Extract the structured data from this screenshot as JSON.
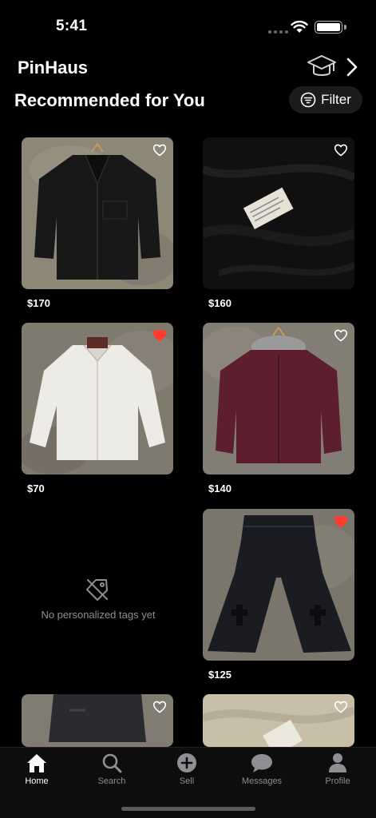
{
  "status": {
    "time": "5:41"
  },
  "header": {
    "app_title": "PinHaus",
    "section_title": "Recommended for You",
    "filter_label": "Filter"
  },
  "colors": {
    "background": "#000000",
    "liked": "#ff3b30",
    "muted": "#8e8e93"
  },
  "items": [
    {
      "price": "$170",
      "liked": false,
      "icon": "leather-jacket"
    },
    {
      "price": "$160",
      "liked": false,
      "icon": "black-fabric-label"
    },
    {
      "price": "$70",
      "liked": true,
      "icon": "white-shirt"
    },
    {
      "price": "$140",
      "liked": false,
      "icon": "burgundy-jacket"
    },
    {
      "price": "$125",
      "liked": true,
      "icon": "black-jeans"
    },
    {
      "price": "",
      "liked": false,
      "icon": "black-jeans-partial"
    },
    {
      "price": "",
      "liked": false,
      "icon": "beige-fabric-partial"
    }
  ],
  "empty_state": {
    "text": "No personalized tags yet",
    "icon": "tag-off-icon"
  },
  "tabs": [
    {
      "label": "Home",
      "icon": "home-icon",
      "active": true
    },
    {
      "label": "Search",
      "icon": "search-icon",
      "active": false
    },
    {
      "label": "Sell",
      "icon": "plus-circle-icon",
      "active": false
    },
    {
      "label": "Messages",
      "icon": "chat-bubble-icon",
      "active": false
    },
    {
      "label": "Profile",
      "icon": "person-icon",
      "active": false
    }
  ]
}
